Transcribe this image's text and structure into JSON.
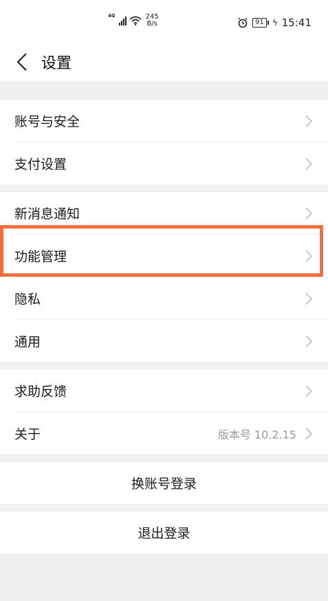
{
  "status_bar": {
    "network": "4G",
    "speed_value": "245",
    "speed_unit": "B/s",
    "battery": "91",
    "time": "15:41",
    "icons": [
      "signal-icon",
      "wifi-icon",
      "alarm-icon",
      "battery-icon",
      "charging-icon"
    ]
  },
  "header": {
    "title": "设置",
    "back_icon": "back-arrow-icon"
  },
  "groups": [
    {
      "items": [
        {
          "label": "账号与安全"
        },
        {
          "label": "支付设置"
        }
      ]
    },
    {
      "items": [
        {
          "label": "新消息通知"
        },
        {
          "label": "功能管理"
        },
        {
          "label": "隐私"
        },
        {
          "label": "通用"
        }
      ]
    },
    {
      "items": [
        {
          "label": "求助反馈"
        },
        {
          "label": "关于",
          "value": "版本号 10.2.15"
        }
      ]
    }
  ],
  "actions": {
    "switch_account": "换账号登录",
    "logout": "退出登录"
  },
  "colors": {
    "highlight": "#f2703f",
    "background": "#f0f0f0",
    "secondary_text": "#9a9a9a"
  }
}
